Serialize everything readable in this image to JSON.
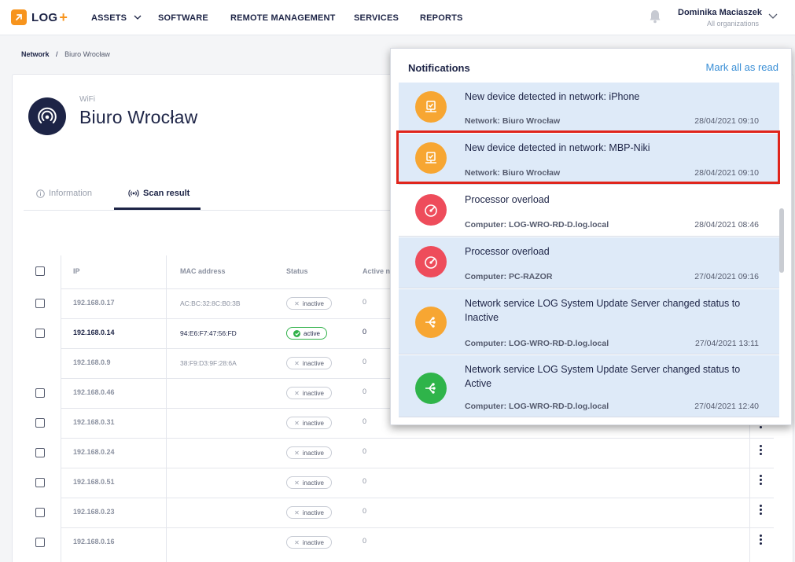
{
  "brand": {
    "name": "LOG",
    "plus": "+"
  },
  "nav": {
    "assets": "ASSETS",
    "software": "SOFTWARE",
    "remote": "REMOTE MANAGEMENT",
    "services": "SERVICES",
    "reports": "REPORTS"
  },
  "user": {
    "name": "Dominika Maciaszek",
    "org": "All organizations"
  },
  "breadcrumb": {
    "root": "Network",
    "sep": "/",
    "current": "Biuro Wrocław"
  },
  "network": {
    "type": "WiFi",
    "title": "Biuro Wrocław"
  },
  "tabs": {
    "information": "Information",
    "scan": "Scan result"
  },
  "table": {
    "headers": {
      "ip": "IP",
      "mac": "MAC address",
      "status": "Status",
      "active": "Active n"
    },
    "rows": [
      {
        "ip": "192.168.0.17",
        "mac": "AC:BC:32:8C:B0:3B",
        "status": "inactive",
        "count": "0"
      },
      {
        "ip": "192.168.0.14",
        "mac": "94:E6:F7:47:56:FD",
        "status": "active",
        "count": "0"
      },
      {
        "ip": "192.168.0.9",
        "mac": "38:F9:D3:9F:28:6A",
        "status": "inactive",
        "count": "0"
      },
      {
        "ip": "192.168.0.46",
        "mac": "",
        "status": "inactive",
        "count": "0"
      },
      {
        "ip": "192.168.0.31",
        "mac": "",
        "status": "inactive",
        "count": "0"
      },
      {
        "ip": "192.168.0.24",
        "mac": "",
        "status": "inactive",
        "count": "0"
      },
      {
        "ip": "192.168.0.51",
        "mac": "",
        "status": "inactive",
        "count": "0"
      },
      {
        "ip": "192.168.0.23",
        "mac": "",
        "status": "inactive",
        "count": "0"
      },
      {
        "ip": "192.168.0.16",
        "mac": "",
        "status": "inactive",
        "count": "0"
      }
    ]
  },
  "notifications": {
    "title": "Notifications",
    "mark_all": "Mark all as read",
    "items": [
      {
        "title": "New device detected in network: iPhone",
        "source": "Network: Biuro Wrocław",
        "time": "28/04/2021 09:10",
        "icon": "device-detected-icon"
      },
      {
        "title": "New device detected in network: MBP-Niki",
        "source": "Network: Biuro Wrocław",
        "time": "28/04/2021 09:10",
        "icon": "device-detected-icon"
      },
      {
        "title": "Processor overload",
        "source": "Computer: LOG-WRO-RD-D.log.local",
        "time": "28/04/2021 08:46",
        "icon": "gauge-icon"
      },
      {
        "title": "Processor overload",
        "source": "Computer: PC-RAZOR",
        "time": "27/04/2021 09:16",
        "icon": "gauge-icon"
      },
      {
        "title": "Network service LOG System Update Server changed status to Inactive",
        "source": "Computer: LOG-WRO-RD-D.log.local",
        "time": "27/04/2021 13:11",
        "icon": "service-icon"
      },
      {
        "title": "Network service LOG System Update Server changed status to Active",
        "source": "Computer: LOG-WRO-RD-D.log.local",
        "time": "27/04/2021 12:40",
        "icon": "service-icon"
      }
    ]
  },
  "colors": {
    "navy": "#1d2446",
    "orange": "#f7941d",
    "red": "#ee4c5b",
    "green": "#2fb44a",
    "unread_bg": "#deeaf8",
    "link": "#3a8fd6",
    "highlight": "#e0251c"
  }
}
